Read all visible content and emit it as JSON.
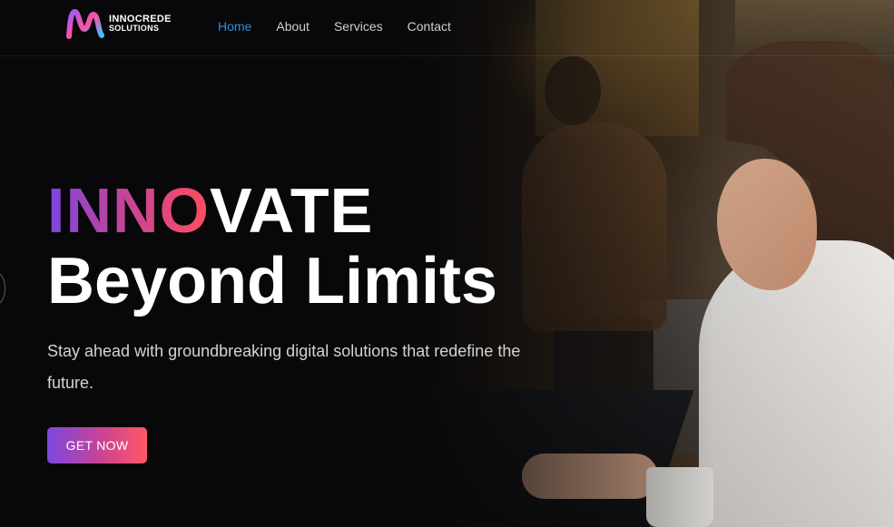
{
  "brand": {
    "name_line1": "INNOCREDE",
    "name_line2": "SOLUTIONS"
  },
  "nav": {
    "items": [
      {
        "label": "Home",
        "active": true
      },
      {
        "label": "About",
        "active": false
      },
      {
        "label": "Services",
        "active": false
      },
      {
        "label": "Contact",
        "active": false
      }
    ]
  },
  "hero": {
    "title_gradient_part": "INNO",
    "title_plain_part": "VATE",
    "title_line2": "Beyond Limits",
    "subtitle": "Stay ahead with groundbreaking digital solutions that redefine the future.",
    "cta_label": "GET NOW"
  },
  "colors": {
    "active_nav": "#2f8de4",
    "gradient_start": "#7b46e0",
    "gradient_mid": "#c2449a",
    "gradient_end": "#ff4d5e",
    "background": "#0b0b0c"
  }
}
